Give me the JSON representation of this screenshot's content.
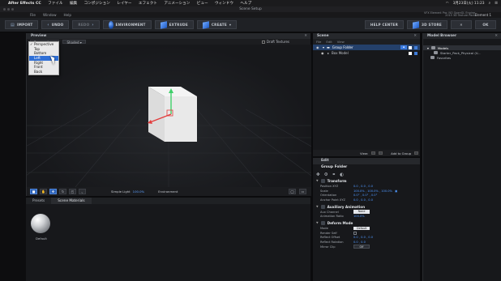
{
  "mac_menu": {
    "app_name": "After Effects CC",
    "items": [
      "ファイル",
      "編集",
      "コンポジション",
      "レイヤー",
      "エフェクト",
      "アニメーション",
      "ビュー",
      "ウィンドウ",
      "ヘルプ"
    ],
    "date_time": "3月23日(火)  11:23"
  },
  "window": {
    "title": "Scene Setup"
  },
  "plugin_menu": {
    "items": [
      "File",
      "Window",
      "Help"
    ],
    "status_line1": "VFX Element Pro: NO OpenGL Engine",
    "status_line2": "2015 3D Texture Pack",
    "element_label": "Element",
    "element_value": "1"
  },
  "toolbar": {
    "import": "IMPORT",
    "undo": "UNDO",
    "redo": "REDO",
    "environment": "ENVIRONMENT",
    "extrude": "EXTRUDE",
    "create": "CREATE",
    "help_center": "HELP CENTER",
    "store": "3D STORE",
    "ok": "OK"
  },
  "preview": {
    "title": "Preview",
    "camera_select": "Perspective",
    "shaded_select": "Shaded",
    "draft_textures": "Draft Textures",
    "camera_options": [
      "Perspective",
      "Top",
      "Bottom",
      "Left",
      "Right",
      "Front",
      "Back"
    ],
    "highlighted_option": "Left",
    "environment_label": "Environment",
    "simple_light_label": "Simple Light",
    "simple_light_value": "100.0%"
  },
  "scene": {
    "title": "Scene",
    "tabs": [
      "File",
      "Edit",
      "View"
    ],
    "rows": [
      {
        "label": "Group Folder",
        "selected": true
      },
      {
        "label": "Box Model",
        "selected": false
      }
    ],
    "footer_view": "View:",
    "footer_add": "Add to Group"
  },
  "edit": {
    "title": "Edit",
    "object": "Group Folder",
    "sections": {
      "transform": "Transform",
      "auxiliary": "Auxiliary Animation",
      "deform": "Deform Mode"
    },
    "transform_props": [
      {
        "name": "Position XYZ",
        "value": "0.0 , 0.0 , 0.0"
      },
      {
        "name": "Scale",
        "value": "100.0% , 100.0% , 100.0%"
      },
      {
        "name": "Orientation",
        "value": "0.0° , 0.0° , 0.0°"
      },
      {
        "name": "Anchor Point XYZ",
        "value": "0.0 , 0.0 , 0.0"
      }
    ],
    "aux_props": [
      {
        "name": "Aux Channel",
        "value": "None"
      },
      {
        "name": "Animation Ratio",
        "value": "100.0%"
      }
    ],
    "deform_props": [
      {
        "name": "Mode",
        "value": "Default"
      },
      {
        "name": "Render Self",
        "value": ""
      },
      {
        "name": "Reflect Offset",
        "value": "0.0 , 0.0 , 0.0"
      },
      {
        "name": "Reflect Rotation",
        "value": "0.0 , 0.0"
      },
      {
        "name": "Mirror Clip",
        "value": "Off"
      }
    ]
  },
  "model_browser": {
    "title": "Model Browser",
    "rows": [
      {
        "label": "Models",
        "selected": true
      },
      {
        "label": "Starter_Pack_Physical (V...",
        "selected": false
      },
      {
        "label": "Favorites",
        "selected": false
      }
    ]
  },
  "presets": {
    "tabs": [
      "Presets",
      "Scene Materials"
    ],
    "active_tab": "Scene Materials",
    "default_label": "Default"
  },
  "colors": {
    "accent": "#2f6fd6",
    "value_blue": "#4f98ff"
  }
}
